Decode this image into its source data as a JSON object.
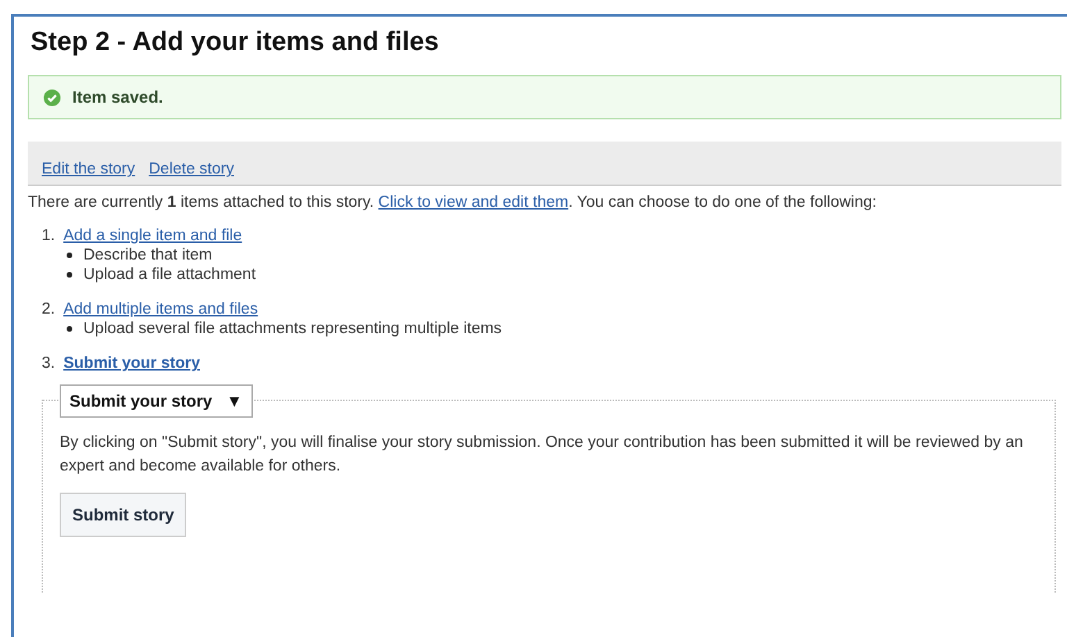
{
  "heading": "Step 2 - Add your items and files",
  "message": {
    "text": "Item saved."
  },
  "actions": [
    "Edit the story",
    "Delete story"
  ],
  "intro": {
    "before": "There are currently **1** items attached to this story. ",
    "link": "Click to view and edit them",
    "after": ". You can choose to do one of the following:"
  },
  "options": [
    {
      "number": "1.",
      "link": "Add a single item and file",
      "bold": false,
      "bullets": [
        "Describe that item",
        "Upload a file attachment"
      ]
    },
    {
      "number": "2.",
      "link": "Add multiple items and files",
      "bold": false,
      "bullets": [
        "Upload several file attachments representing multiple items"
      ]
    },
    {
      "number": "3.",
      "link": "Submit your story",
      "bold": true
    }
  ],
  "fieldset": {
    "legend": "Submit your story",
    "toggle": "▼",
    "expanded": true,
    "description": "By clicking on \"Submit story\", you will finalise your story submission. Once your contribution has been submitted it will be reviewed by an expert and become available for others.",
    "button": "Submit story"
  }
}
